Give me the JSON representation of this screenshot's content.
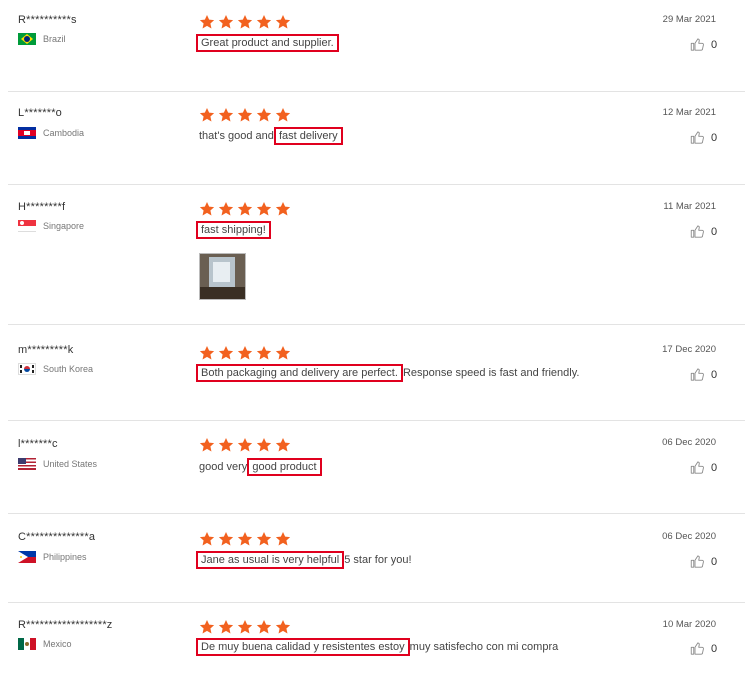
{
  "reviews": [
    {
      "user": "R**********s",
      "country": "Brazil",
      "flag": "brazil",
      "stars": 5,
      "date": "29 Mar 2021",
      "likes": "0",
      "parts": [
        {
          "text": "Great product and supplier.",
          "highlight": true
        }
      ]
    },
    {
      "user": "L*******o",
      "country": "Cambodia",
      "flag": "cambodia",
      "stars": 5,
      "date": "12 Mar 2021",
      "likes": "0",
      "parts": [
        {
          "text": "that's good and ",
          "highlight": false
        },
        {
          "text": "fast delivery",
          "highlight": true
        }
      ]
    },
    {
      "user": "H********f",
      "country": "Singapore",
      "flag": "singapore",
      "stars": 5,
      "date": "11 Mar 2021",
      "likes": "0",
      "parts": [
        {
          "text": "fast shipping!",
          "highlight": true
        }
      ],
      "has_photo": true
    },
    {
      "user": "m*********k",
      "country": "South Korea",
      "flag": "south-korea",
      "stars": 5,
      "date": "17 Dec 2020",
      "likes": "0",
      "parts": [
        {
          "text": "Both packaging and delivery are perfect.",
          "highlight": true
        },
        {
          "text": " Response speed is fast and friendly.",
          "highlight": false
        }
      ]
    },
    {
      "user": "l*******c",
      "country": "United States",
      "flag": "united-states",
      "stars": 5,
      "date": "06 Dec 2020",
      "likes": "0",
      "parts": [
        {
          "text": "good very ",
          "highlight": false
        },
        {
          "text": "good product",
          "highlight": true
        }
      ]
    },
    {
      "user": "C**************a",
      "country": "Philippines",
      "flag": "philippines",
      "stars": 5,
      "date": "06 Dec 2020",
      "likes": "0",
      "parts": [
        {
          "text": "Jane as usual is very helpful",
          "highlight": true
        },
        {
          "text": " 5 star for you!",
          "highlight": false
        }
      ]
    },
    {
      "user": "R******************z",
      "country": "Mexico",
      "flag": "mexico",
      "stars": 5,
      "date": "10 Mar 2020",
      "likes": "0",
      "parts": [
        {
          "text": "De muy buena calidad y resistentes estoy",
          "highlight": true
        },
        {
          "text": " muy satisfecho con mi compra",
          "highlight": false
        }
      ]
    }
  ],
  "colors": {
    "star": "#f2611f",
    "highlight_border": "#e0001e"
  },
  "icons": {
    "star": "star-icon",
    "like": "thumbs-up-icon"
  }
}
